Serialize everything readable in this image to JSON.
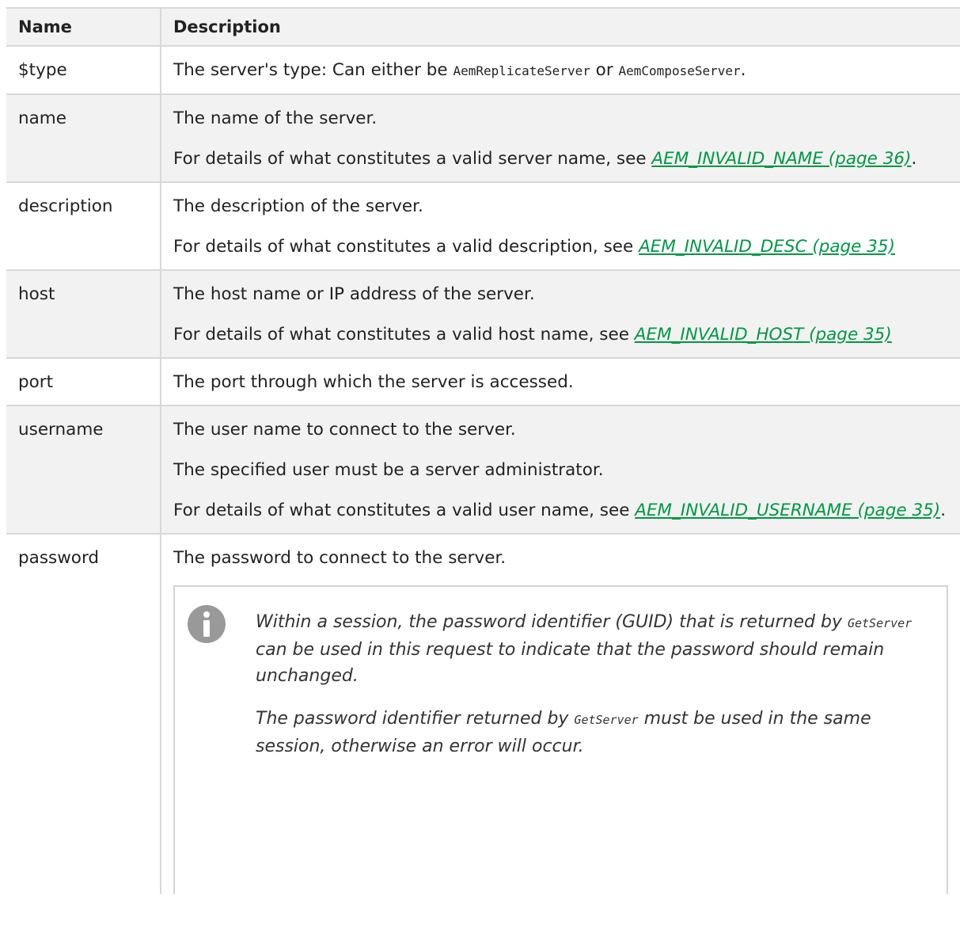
{
  "table": {
    "headers": {
      "name": "Name",
      "description": "Description"
    },
    "rows": {
      "type": {
        "name": "$type",
        "desc_before": "The server's type: Can either be ",
        "code1": "AemReplicateServer",
        "desc_mid": " or ",
        "code2": "AemComposeServer",
        "desc_after": "."
      },
      "name": {
        "name": "name",
        "line1": "The name of the server.",
        "line2_before": "For details of what constitutes a valid server name, see ",
        "link": "AEM_INVALID_NAME (page 36)",
        "line2_after": "."
      },
      "description": {
        "name": "description",
        "line1": "The description of the server.",
        "line2_before": "For details of what constitutes a valid description, see ",
        "link": "AEM_INVALID_DESC (page 35)",
        "line2_after": ""
      },
      "host": {
        "name": "host",
        "line1": "The host name or IP address of the server.",
        "line2_before": "For details of what constitutes a valid host name, see ",
        "link": "AEM_INVALID_HOST (page 35)",
        "line2_after": ""
      },
      "port": {
        "name": "port",
        "line1": "The port through which the server is accessed."
      },
      "username": {
        "name": "username",
        "line1": "The user name to connect to the server.",
        "line2": "The specified user must be a server administrator.",
        "line3_before": "For details of what constitutes a valid user name, see ",
        "link": "AEM_INVALID_USERNAME (page 35)",
        "line3_after": "."
      },
      "password": {
        "name": "password",
        "line1": "The password to connect to the server.",
        "note": {
          "icon": "info-icon",
          "p1_before": "Within a session, the password identifier (GUID) that is returned by ",
          "p1_code": "GetServer",
          "p1_after": " can be used in this request to indicate that the password should remain unchanged.",
          "p2_before": "The password identifier returned by ",
          "p2_code": "GetServer",
          "p2_after": " must be used in the same session, otherwise an error will occur."
        }
      }
    }
  },
  "colors": {
    "link": "#009845",
    "header_bg": "#f2f2f2",
    "border": "#d8d8d8",
    "icon": "#999999"
  }
}
